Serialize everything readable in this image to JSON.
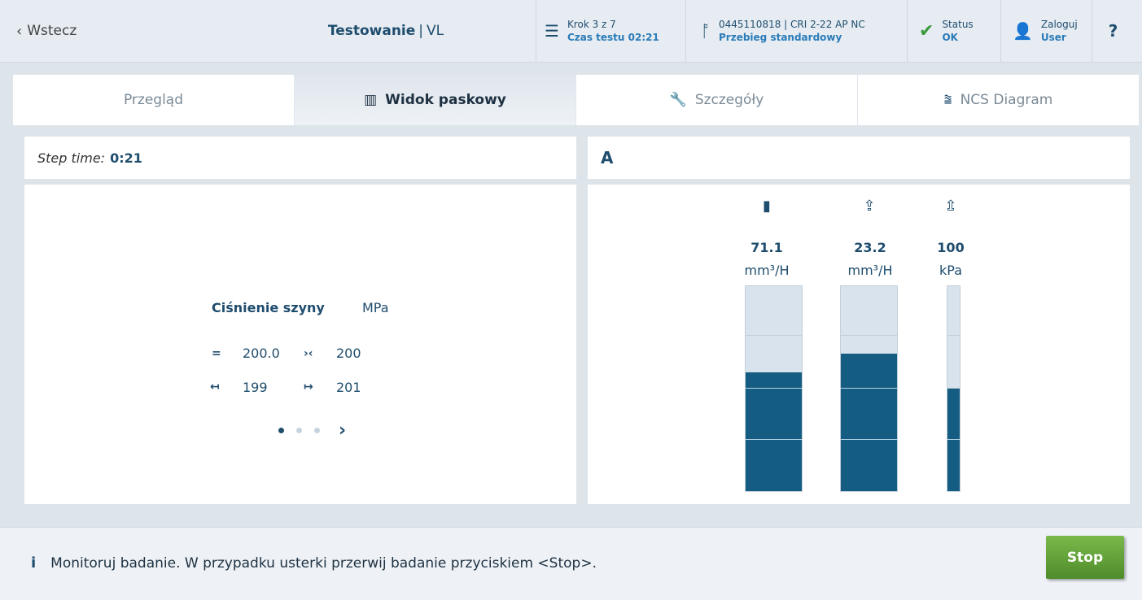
{
  "header": {
    "back_label": "Wstecz",
    "title_bold": "Testowanie",
    "title_sep": "|",
    "title_rest": "VL",
    "step": {
      "line1": "Krok 3 z 7",
      "line2": "Czas testu 02:21"
    },
    "program": {
      "line1": "0445110818 | CRI 2-22 AP NC",
      "line2": "Przebieg standardowy"
    },
    "status": {
      "line1": "Status",
      "line2": "OK"
    },
    "login": {
      "line1": "Zaloguj",
      "line2": "User"
    },
    "help": "?"
  },
  "tabs": [
    {
      "label": "Przegląd",
      "active": false
    },
    {
      "label": "Widok paskowy",
      "active": true
    },
    {
      "label": "Szczegóły",
      "active": false
    },
    {
      "label": "NCS Diagram",
      "active": false
    }
  ],
  "left": {
    "step_time_label": "Step time:",
    "step_time_value": "0:21",
    "card": {
      "title": "Ciśnienie szyny",
      "unit": "MPa",
      "rows": [
        {
          "sym1": "=",
          "val1": "200.0",
          "sym2": "›‹",
          "val2": "200"
        },
        {
          "sym1": "↤",
          "val1": "199",
          "sym2": "↦",
          "val2": "201"
        }
      ]
    },
    "pager": {
      "count": 3,
      "active": 0
    }
  },
  "right": {
    "header": "A",
    "bars": [
      {
        "icon": "injector-icon",
        "value": "71.1",
        "unit": "mm³/H",
        "fill": 0.58
      },
      {
        "icon": "delivery-icon",
        "value": "23.2",
        "unit": "mm³/H",
        "fill": 0.67
      },
      {
        "icon": "backflow-icon",
        "value": "100",
        "unit": "kPa",
        "fill": 0.5
      }
    ]
  },
  "footer": {
    "info": "Monitoruj badanie. W przypadku usterki przerwij badanie przyciskiem <Stop>.",
    "stop_label": "Stop"
  },
  "colors": {
    "accent": "#1f4d6e",
    "bar_fill": "#145c82",
    "bar_bg": "#d8e3ed",
    "stop_green": "#5f9f36",
    "status_ok": "#3c9a3c"
  }
}
